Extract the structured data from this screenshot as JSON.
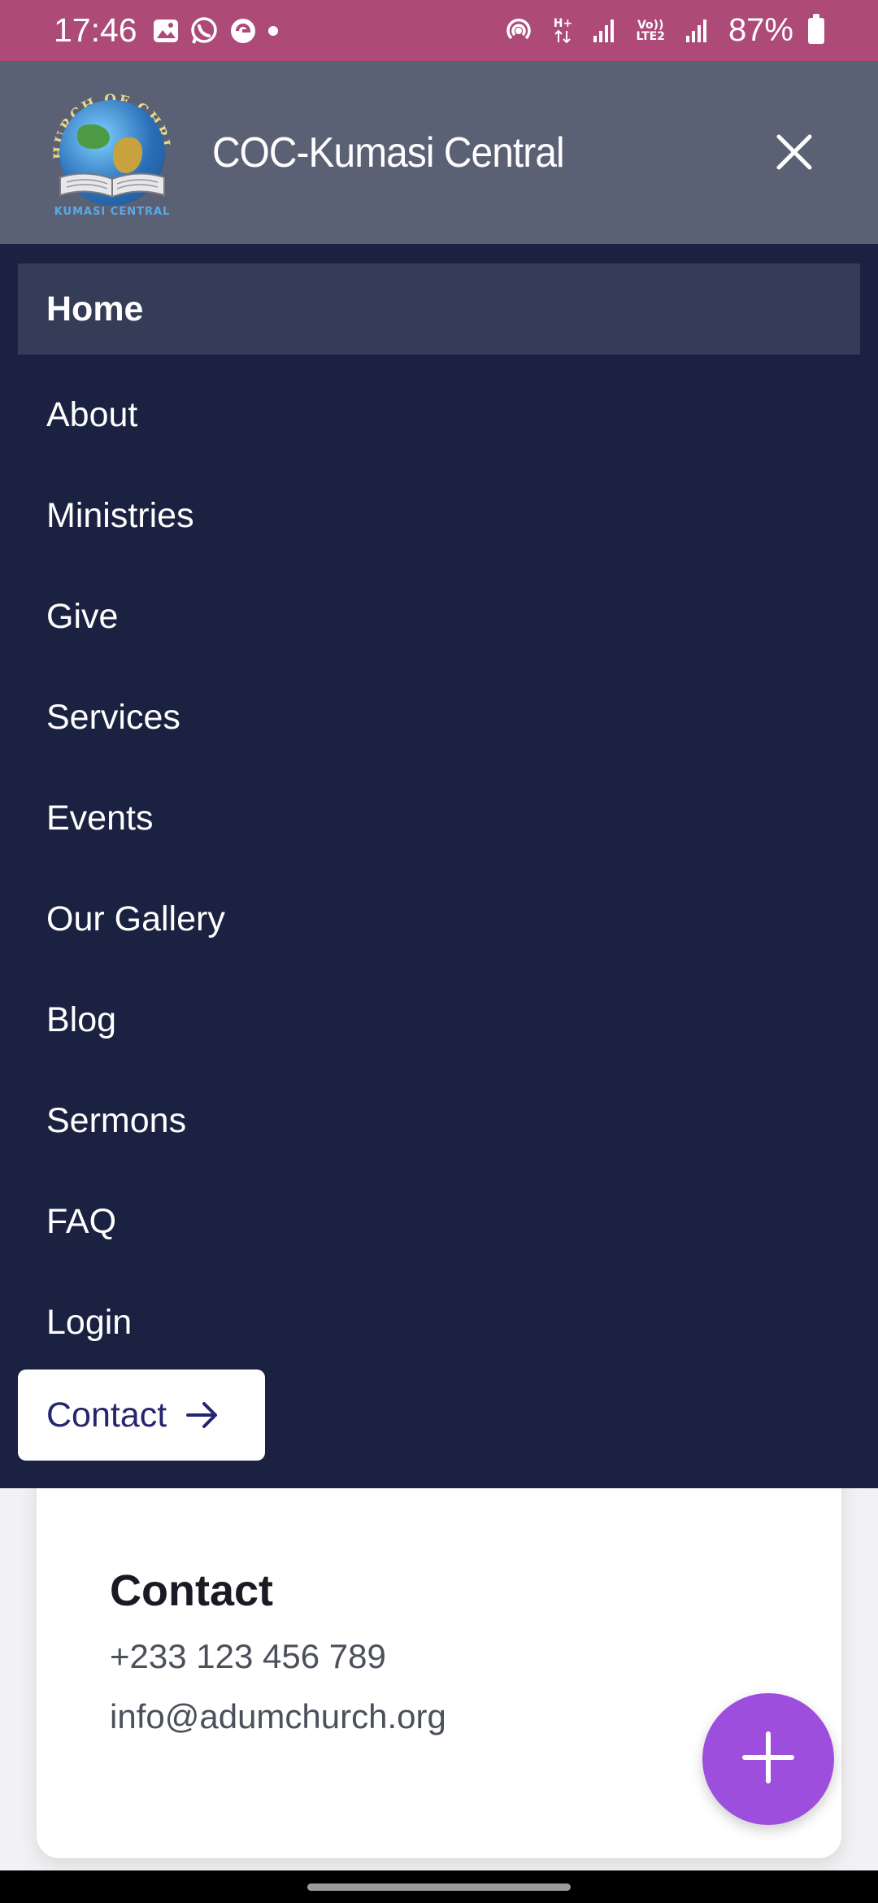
{
  "status_bar": {
    "time": "17:46",
    "left_icons": [
      "gallery-icon",
      "whatsapp-icon",
      "app-icon",
      "dot-icon"
    ],
    "net_label_1": "H+",
    "net_label_2": "Vo))",
    "net_label_3": "LTE2",
    "battery": "87%"
  },
  "header": {
    "brand": "COC-Kumasi Central",
    "logo_text_top": "CHURCH OF CHRIST",
    "logo_text_bottom": "KUMASI CENTRAL"
  },
  "nav": {
    "items": [
      {
        "label": "Home",
        "active": true
      },
      {
        "label": "About"
      },
      {
        "label": "Ministries"
      },
      {
        "label": "Give"
      },
      {
        "label": "Services"
      },
      {
        "label": "Events"
      },
      {
        "label": "Our Gallery"
      },
      {
        "label": "Blog"
      },
      {
        "label": "Sermons"
      },
      {
        "label": "FAQ"
      },
      {
        "label": "Login"
      }
    ],
    "contact_button": "Contact"
  },
  "contact_card": {
    "title": "Contact",
    "phone": "+233 123 456 789",
    "email": "info@adumchurch.org"
  },
  "colors": {
    "status_bar": "#ad4a78",
    "drawer_header": "#5b6175",
    "drawer": "#1b2241",
    "active_item": "#343c57",
    "fab": "#9d4edd"
  }
}
